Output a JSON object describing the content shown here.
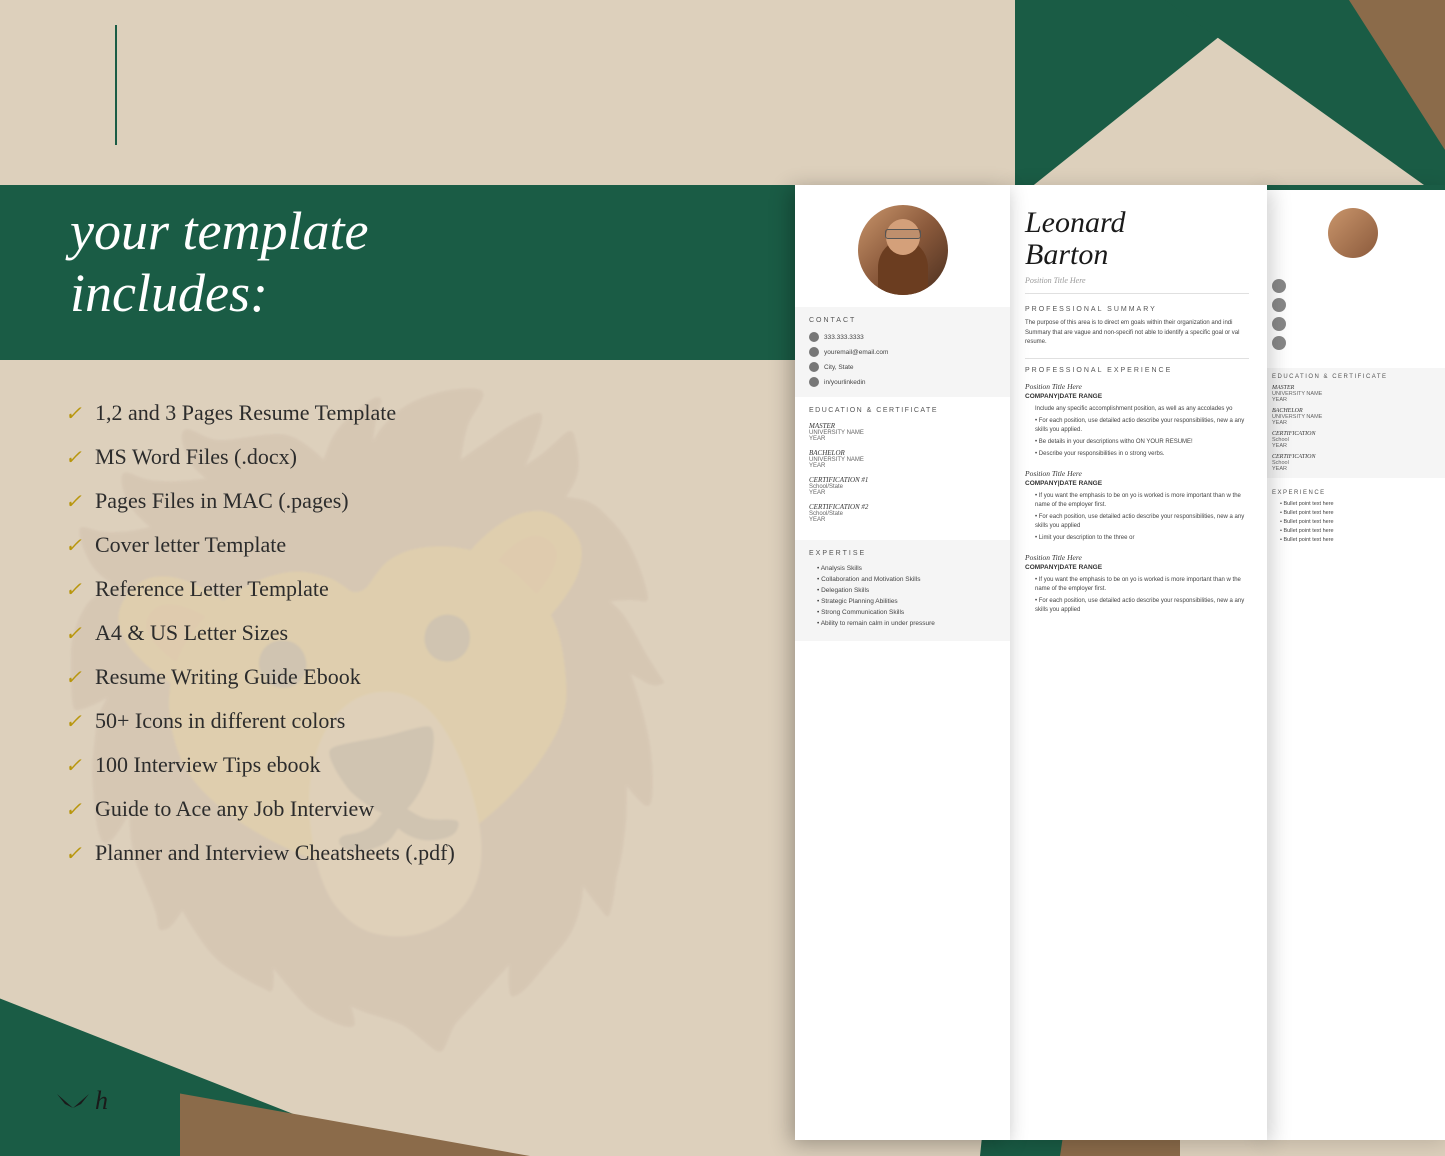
{
  "background": {
    "main_color": "#ddd0bc",
    "teal_color": "#1a5c45",
    "brown_color": "#8B6B4A"
  },
  "title": {
    "line1": "your template",
    "line2": "includes:"
  },
  "checklist": [
    "1,2 and 3 Pages Resume Template",
    "MS Word Files (.docx)",
    "Pages Files in MAC (.pages)",
    "Cover letter Template",
    "Reference Letter Template",
    "A4 & US Letter Sizes",
    "Resume Writing Guide Ebook",
    "50+ Icons in different colors",
    "100 Interview Tips ebook",
    "Guide to Ace any Job Interview",
    "Planner and Interview Cheatsheets (.pdf)"
  ],
  "logo": {
    "symbol": "🦅",
    "letter": "h"
  },
  "resume": {
    "name_line1": "Leonard",
    "name_line2": "Barton",
    "position_title": "Position Title Here",
    "contact_section": "CONTACT",
    "phone": "333.333.3333",
    "email": "youremail@email.com",
    "location": "City, State",
    "linkedin": "in/yourlinkedin",
    "education_title": "EDUCATION & CERTIFICATE",
    "degree1": "MASTER",
    "school1": "UNIVERSITY NAME",
    "year1": "YEAR",
    "degree2": "BACHELOR",
    "school2": "UNIVERSITY NAME",
    "year2": "YEAR",
    "cert1": "CERTIFICATION #1",
    "cert1_school": "School/State",
    "cert1_year": "YEAR",
    "cert2": "CERTIFICATION #2",
    "cert2_school": "School/State",
    "cert2_year": "YEAR",
    "expertise_title": "EXPERTISE",
    "skills": [
      "Analysis Skills",
      "Collaboration and Motivation Skills",
      "Delegation Skills",
      "Strategic Planning Abilities",
      "Strong Communication Skills",
      "Ability to remain calm in under pressure"
    ],
    "professional_summary_title": "PROFESSIONAL SUMMARY",
    "professional_summary": "The purpose of this area is to direct em goals within their organization and indi Summary that are vague and non-specifi not able to identify a specific goal or val resume.",
    "professional_exp_title": "PROFESSIONAL EXPERIENCE",
    "exp1_position": "Position Title Here",
    "exp1_company": "COMPANY|DATE RANGE",
    "exp1_bullets": [
      "Include any specific accomplishment position, as well as any accolades yo",
      "For each position, use detailed actio describe your responsibilities, new a any skills you applied.",
      "Be details in your descriptions witho ON YOUR RESUME!",
      "Describe your responsibilities in o strong verbs."
    ],
    "exp2_position": "Position Title Here",
    "exp2_company": "COMPANY|DATE RANGE",
    "exp2_bullets": [
      "If you want the emphasis to be on yo is worked is more important than w the name of the employer first.",
      "For each position, use detailed actio describe your responsibilities, new a any skills you applied",
      "Limit your description to the three or"
    ],
    "exp3_position": "Position Title Here",
    "exp3_company": "COMPANY|DATE RANGE",
    "exp3_bullets": [
      "If you want the emphasis to be on yo is worked is more important than w the name of the employer first.",
      "For each position, use detailed actio describe your responsibilities, new a any skills you applied"
    ]
  }
}
